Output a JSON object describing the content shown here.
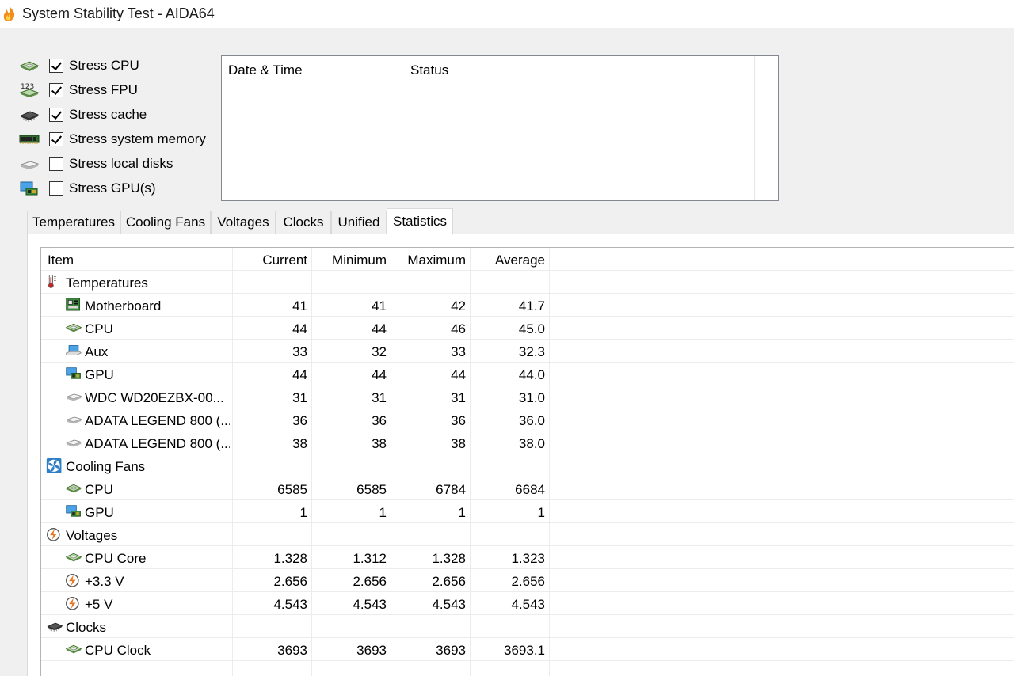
{
  "window": {
    "title": "System Stability Test - AIDA64",
    "icon": "flame-icon"
  },
  "stress_options": [
    {
      "label": "Stress CPU",
      "checked": true,
      "icon": "cpu-chip-icon"
    },
    {
      "label": "Stress FPU",
      "checked": true,
      "icon": "fpu-123-icon"
    },
    {
      "label": "Stress cache",
      "checked": true,
      "icon": "cache-chip-icon"
    },
    {
      "label": "Stress system memory",
      "checked": true,
      "icon": "memory-module-icon"
    },
    {
      "label": "Stress local disks",
      "checked": false,
      "icon": "disk-drive-icon"
    },
    {
      "label": "Stress GPU(s)",
      "checked": false,
      "icon": "gpu-monitor-icon"
    }
  ],
  "log": {
    "columns": [
      "Date & Time",
      "Status"
    ]
  },
  "tabs": [
    {
      "label": "Temperatures",
      "active": false
    },
    {
      "label": "Cooling Fans",
      "active": false
    },
    {
      "label": "Voltages",
      "active": false
    },
    {
      "label": "Clocks",
      "active": false
    },
    {
      "label": "Unified",
      "active": false
    },
    {
      "label": "Statistics",
      "active": true
    }
  ],
  "stats": {
    "columns": [
      "Item",
      "Current",
      "Minimum",
      "Maximum",
      "Average"
    ],
    "rows": [
      {
        "type": "group",
        "label": "Temperatures",
        "icon": "thermometer-icon"
      },
      {
        "type": "item",
        "label": "Motherboard",
        "icon": "motherboard-icon",
        "current": "41",
        "minimum": "41",
        "maximum": "42",
        "average": "41.7"
      },
      {
        "type": "item",
        "label": "CPU",
        "icon": "cpu-chip-icon",
        "current": "44",
        "minimum": "44",
        "maximum": "46",
        "average": "45.0"
      },
      {
        "type": "item",
        "label": "Aux",
        "icon": "laptop-icon",
        "current": "33",
        "minimum": "32",
        "maximum": "33",
        "average": "32.3"
      },
      {
        "type": "item",
        "label": "GPU",
        "icon": "gpu-monitor-icon",
        "current": "44",
        "minimum": "44",
        "maximum": "44",
        "average": "44.0"
      },
      {
        "type": "item",
        "label": "WDC WD20EZBX-00...",
        "icon": "disk-drive-icon",
        "current": "31",
        "minimum": "31",
        "maximum": "31",
        "average": "31.0"
      },
      {
        "type": "item",
        "label": "ADATA LEGEND 800 (...",
        "icon": "disk-drive-icon",
        "current": "36",
        "minimum": "36",
        "maximum": "36",
        "average": "36.0"
      },
      {
        "type": "item",
        "label": "ADATA LEGEND 800 (...",
        "icon": "disk-drive-icon",
        "current": "38",
        "minimum": "38",
        "maximum": "38",
        "average": "38.0"
      },
      {
        "type": "group",
        "label": "Cooling Fans",
        "icon": "fan-icon"
      },
      {
        "type": "item",
        "label": "CPU",
        "icon": "cpu-chip-icon",
        "current": "6585",
        "minimum": "6585",
        "maximum": "6784",
        "average": "6684"
      },
      {
        "type": "item",
        "label": "GPU",
        "icon": "gpu-monitor-icon",
        "current": "1",
        "minimum": "1",
        "maximum": "1",
        "average": "1"
      },
      {
        "type": "group",
        "label": "Voltages",
        "icon": "voltage-icon"
      },
      {
        "type": "item",
        "label": "CPU Core",
        "icon": "cpu-chip-icon",
        "current": "1.328",
        "minimum": "1.312",
        "maximum": "1.328",
        "average": "1.323"
      },
      {
        "type": "item",
        "label": "+3.3 V",
        "icon": "voltage-icon",
        "current": "2.656",
        "minimum": "2.656",
        "maximum": "2.656",
        "average": "2.656"
      },
      {
        "type": "item",
        "label": "+5 V",
        "icon": "voltage-icon",
        "current": "4.543",
        "minimum": "4.543",
        "maximum": "4.543",
        "average": "4.543"
      },
      {
        "type": "group",
        "label": "Clocks",
        "icon": "cache-chip-icon"
      },
      {
        "type": "item",
        "label": "CPU Clock",
        "icon": "cpu-chip-icon",
        "current": "3693",
        "minimum": "3693",
        "maximum": "3693",
        "average": "3693.1"
      }
    ]
  }
}
